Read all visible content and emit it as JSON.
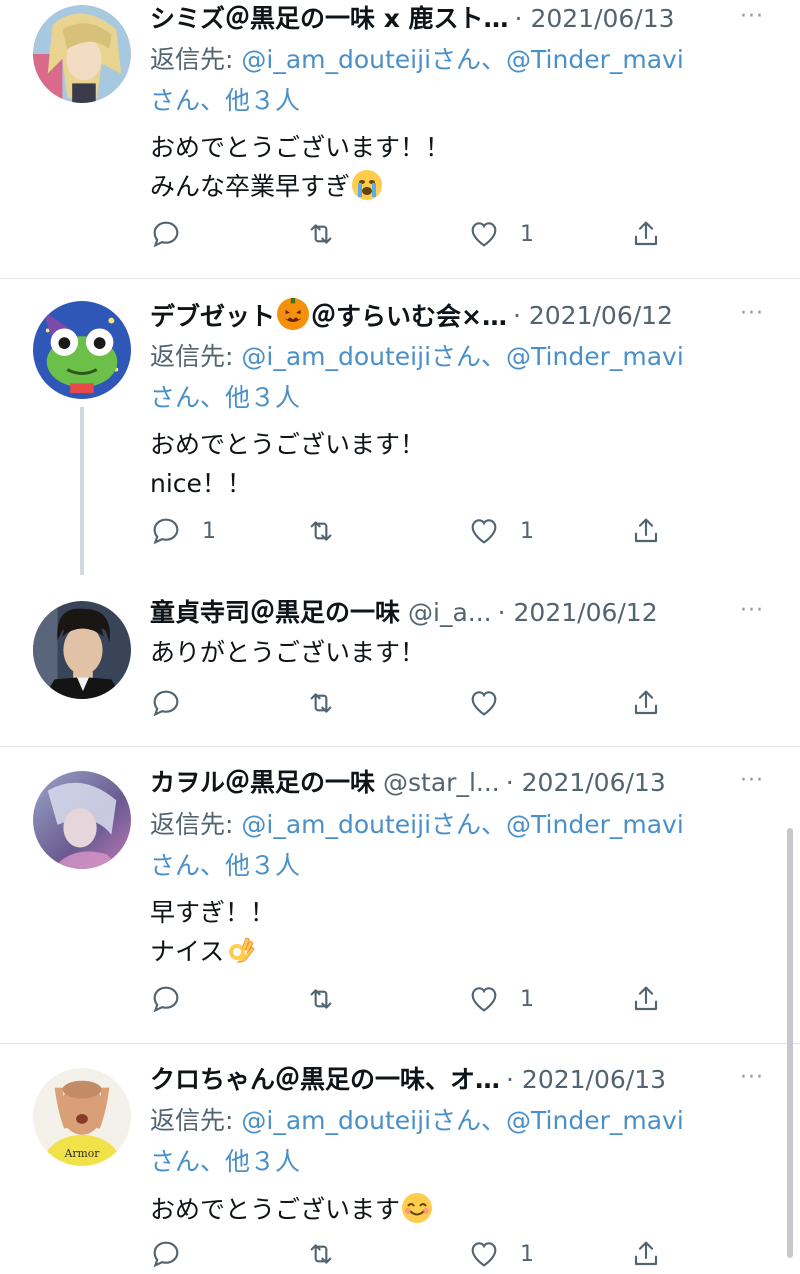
{
  "tweets": [
    {
      "name": "シミズ＠黒足の一味 x 鹿スト…",
      "handle": "",
      "date": "· 2021/06/13",
      "reply_prefix": "返信先: ",
      "reply_link1": "@i_am_douteiji",
      "reply_mid": "さん、",
      "reply_link2": "@Tinder_mavi",
      "reply_line2": "さん、他３人",
      "body_line1": "おめでとうございます！！",
      "body_line2": "みんな卒業早すぎ",
      "body_emoji": "loudly-crying-face",
      "reply_count": "",
      "retweet_count": "",
      "like_count": "1"
    },
    {
      "name": "デブゼット",
      "name_emoji": "jack-o-lantern",
      "name_rest": "＠すらいむ会×…",
      "handle": "",
      "date": "· 2021/06/12",
      "reply_prefix": "返信先: ",
      "reply_link1": "@i_am_douteiji",
      "reply_mid": "さん、",
      "reply_link2": "@Tinder_mavi",
      "reply_line2": "さん、他３人",
      "body_line1": "おめでとうございます！",
      "body_line2": "nice！！",
      "reply_count": "1",
      "retweet_count": "",
      "like_count": "1"
    },
    {
      "name": "童貞寺司＠黒足の一味",
      "handle": "@i_a...",
      "date": "· 2021/06/12",
      "body_line1": "ありがとうございます！",
      "reply_count": "",
      "retweet_count": "",
      "like_count": ""
    },
    {
      "name": "カヲル＠黒足の一味",
      "handle": "@star_l...",
      "date": "· 2021/06/13",
      "reply_prefix": "返信先: ",
      "reply_link1": "@i_am_douteiji",
      "reply_mid": "さん、",
      "reply_link2": "@Tinder_mavi",
      "reply_line2": "さん、他３人",
      "body_line1": "早すぎ！！",
      "body_line2": "ナイス",
      "body_emoji": "ok-hand",
      "reply_count": "",
      "retweet_count": "",
      "like_count": "1"
    },
    {
      "name": "クロちゃん＠黒足の一味、オ…",
      "handle": "",
      "date": "· 2021/06/13",
      "reply_prefix": "返信先: ",
      "reply_link1": "@i_am_douteiji",
      "reply_mid": "さん、",
      "reply_link2": "@Tinder_mavi",
      "reply_line2": "さん、他３人",
      "body_line1": "おめでとうございます",
      "body_emoji": "smiling-face",
      "reply_count": "",
      "retweet_count": "",
      "like_count": "1"
    }
  ],
  "more_label": "···",
  "avatar4_text": "Armor",
  "colors": {
    "text": "#0f1419",
    "secondary": "#536471",
    "link": "#4a90c8",
    "divider": "#e1e4e8",
    "thread_line": "#cfd9de"
  }
}
